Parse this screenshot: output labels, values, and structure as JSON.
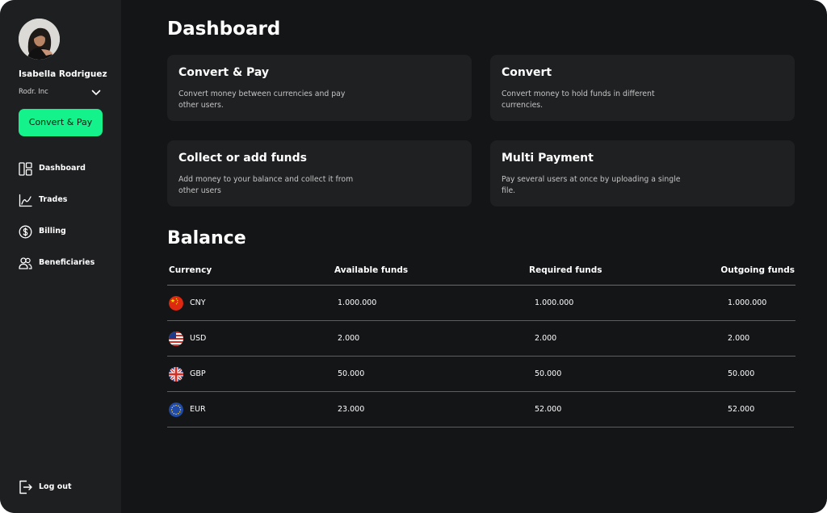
{
  "user": {
    "name": "Isabella Rodriguez",
    "company": "Rodr. Inc"
  },
  "sidebar": {
    "cta_label": "Convert & Pay",
    "items": [
      {
        "label": "Dashboard",
        "icon": "dashboard-icon"
      },
      {
        "label": "Trades",
        "icon": "chart-icon"
      },
      {
        "label": "Billing",
        "icon": "dollar-icon"
      },
      {
        "label": "Beneficiaries",
        "icon": "users-icon"
      }
    ],
    "logout_label": "Log out"
  },
  "main": {
    "title": "Dashboard",
    "cards": [
      {
        "title": "Convert & Pay",
        "description": "Convert money between currencies and pay other users."
      },
      {
        "title": "Convert",
        "description": "Convert money to hold funds in different currencies."
      },
      {
        "title": "Collect or add funds",
        "description": "Add money to your balance and collect it from other users"
      },
      {
        "title": "Multi Payment",
        "description": "Pay several users at once by uploading a single file."
      }
    ]
  },
  "balance": {
    "title": "Balance",
    "columns": [
      "Currency",
      "Available funds",
      "Required funds",
      "Outgoing funds"
    ],
    "rows": [
      {
        "currency": "CNY",
        "available": "1.000.000",
        "required": "1.000.000",
        "outgoing": "1.000.000"
      },
      {
        "currency": "USD",
        "available": "2.000",
        "required": "2.000",
        "outgoing": "2.000"
      },
      {
        "currency": "GBP",
        "available": "50.000",
        "required": "50.000",
        "outgoing": "50.000"
      },
      {
        "currency": "EUR",
        "available": "23.000",
        "required": "52.000",
        "outgoing": "52.000"
      }
    ]
  },
  "colors": {
    "accent": "#14f28c",
    "background": "#141517",
    "sidebar": "#1e1f21",
    "card": "#1f2022"
  }
}
